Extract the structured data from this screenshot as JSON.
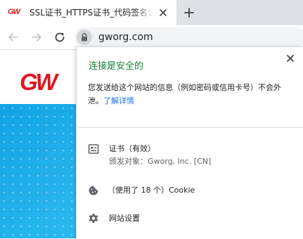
{
  "tab": {
    "favicon_text": "GW",
    "title": "SSL证书_HTTPS证书_代码签名证书"
  },
  "icons": {
    "tab_close": "close-icon",
    "new_tab": "plus-icon",
    "back": "arrow-back-icon",
    "forward": "arrow-forward-icon",
    "reload": "reload-icon",
    "lock": "lock-icon",
    "popup_close": "close-icon",
    "certificate": "certificate-icon",
    "cookie": "cookie-icon",
    "settings": "gear-icon"
  },
  "omnibox": {
    "url": "gworg.com"
  },
  "page": {
    "logo_text": "GW"
  },
  "popup": {
    "title": "连接是安全的",
    "description": "您发送给这个网站的信息（例如密码或信用卡号）不会外泄。",
    "learn_more": "了解详情",
    "certificate": {
      "title": "证书（有效）",
      "subtitle": "颁发对象：Gworg, Inc. [CN]"
    },
    "cookies": {
      "label": "（使用了 18 个）Cookie"
    },
    "site_settings": {
      "label": "网站设置"
    }
  },
  "colors": {
    "secure_green": "#188038",
    "link_blue": "#1a73e8",
    "brand_red": "#e0161e",
    "hero_blue": "#1aa6e6",
    "tabstrip_gray": "#dee1e6"
  }
}
